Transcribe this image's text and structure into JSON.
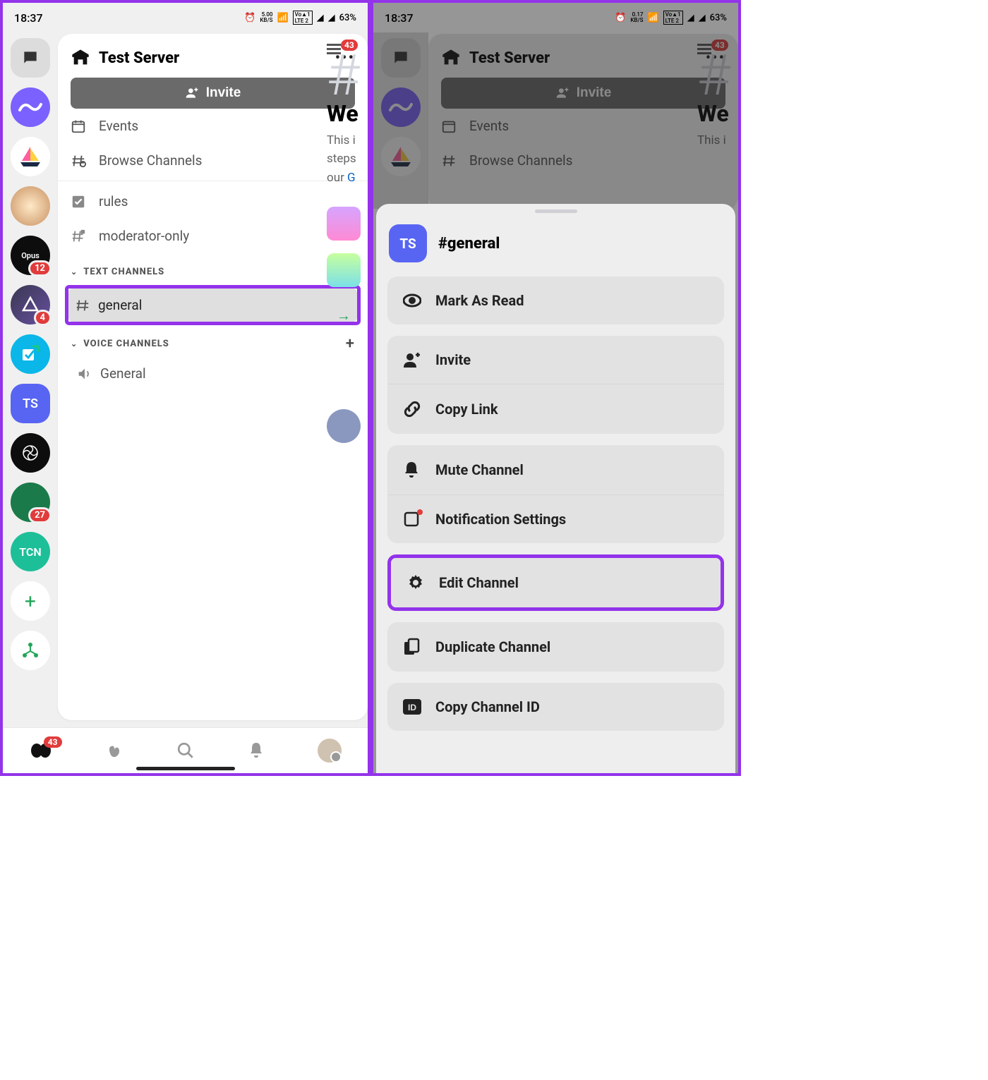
{
  "status": {
    "time": "18:37",
    "kbps_left": "5.00",
    "kbps_right": "0.17",
    "kbps_unit": "KB/S",
    "battery": "63%"
  },
  "server": {
    "name": "Test Server",
    "invite": "Invite",
    "events": "Events",
    "browse": "Browse Channels",
    "rules": "rules",
    "moderator": "moderator-only",
    "text_channels": "TEXT CHANNELS",
    "general": "general",
    "voice_channels": "VOICE CHANNELS",
    "voice_general": "General"
  },
  "rail": {
    "ts": "TS",
    "opus": "Opus",
    "tcn": "TCN",
    "badges": {
      "opus": "12",
      "tri": "4",
      "avatar": "27"
    }
  },
  "peek": {
    "badge": "43",
    "welcome": "We",
    "line1": "This i",
    "line2": "steps",
    "line3_pre": "our ",
    "line3_link": "G"
  },
  "bottom": {
    "badge": "43"
  },
  "sheet": {
    "ts": "TS",
    "title": "#general",
    "mark_read": "Mark As Read",
    "invite": "Invite",
    "copy_link": "Copy Link",
    "mute": "Mute Channel",
    "notif": "Notification Settings",
    "edit": "Edit Channel",
    "duplicate": "Duplicate Channel",
    "copy_id": "Copy Channel ID"
  }
}
